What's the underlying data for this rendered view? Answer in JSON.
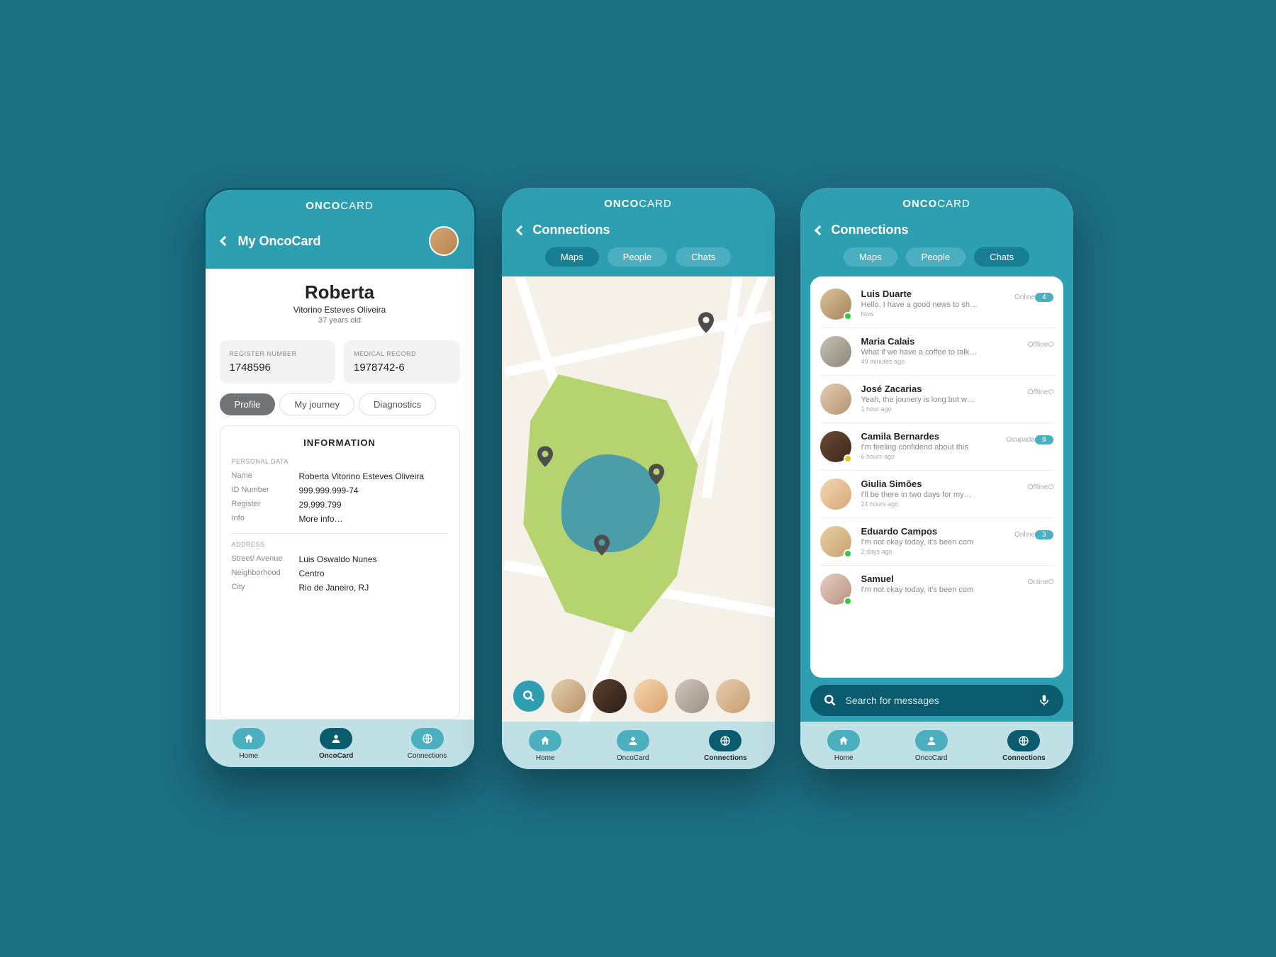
{
  "brand": {
    "bold": "ONCO",
    "light": "CARD"
  },
  "nav": {
    "home": "Home",
    "oncocard": "OncoCard",
    "connections": "Connections"
  },
  "screen1": {
    "title": "My OncoCard",
    "name": "Roberta",
    "fullname": "Vitorino Esteves Oliveira",
    "age": "37 years old",
    "register_label": "REGISTER NUMBER",
    "register_value": "1748596",
    "medical_label": "MEDICAL RECORD",
    "medical_value": "1978742-6",
    "tabs": {
      "profile": "Profile",
      "journey": "My journey",
      "diag": "Diagnostics"
    },
    "info_title": "INFORMATION",
    "personal": {
      "heading": "PERSONAL DATA",
      "name_l": "Name",
      "name_v": "Roberta Vitorino Esteves Oliveira",
      "id_l": "ID Number",
      "id_v": "999.999.999-74",
      "reg_l": "Register",
      "reg_v": "29.999.799",
      "info_l": "Info",
      "info_v": "More info…"
    },
    "address": {
      "heading": "ADDRESS",
      "street_l": "Street/ Avenue",
      "street_v": "Luis Oswaldo Nunes",
      "neigh_l": "Neighborhood",
      "neigh_v": "Centro",
      "city_l": "City",
      "city_v": "Rio de Janeiro, RJ"
    }
  },
  "screen2": {
    "title": "Connections",
    "tabs": {
      "maps": "Maps",
      "people": "People",
      "chats": "Chats"
    }
  },
  "screen3": {
    "title": "Connections",
    "tabs": {
      "maps": "Maps",
      "people": "People",
      "chats": "Chats"
    },
    "search_placeholder": "Search for messages",
    "chats": [
      {
        "name": "Luis Duarte",
        "msg": "Hello, I have a good news to sh…",
        "time": "Now",
        "status": "Online",
        "badge": "4",
        "presence": "online",
        "bg": "linear-gradient(135deg,#d9c29a,#a7855c)"
      },
      {
        "name": "Maria Calais",
        "msg": "What if we have a coffee to talk…",
        "time": "49 minutes ago",
        "status": "Offline",
        "presence": "offline",
        "bg": "linear-gradient(135deg,#c9c2b4,#8a8578)"
      },
      {
        "name": "José Zacarias",
        "msg": "Yeah, the jounery is long but w…",
        "time": "1 hour ago",
        "status": "Offline",
        "presence": "offline",
        "bg": "linear-gradient(135deg,#e4cdb3,#b59373)"
      },
      {
        "name": "Camila Bernardes",
        "msg": "I'm feeling confidend about this",
        "time": "6 hours ago",
        "status": "Ocupada",
        "badge": "9",
        "presence": "busy",
        "bg": "linear-gradient(135deg,#6b4a35,#3c271a)"
      },
      {
        "name": "Giulia Simões",
        "msg": "I'll be there in two days for my…",
        "time": "24 hours ago",
        "status": "Offline",
        "presence": "offline",
        "bg": "linear-gradient(135deg,#f3d7b4,#d9a777)"
      },
      {
        "name": "Eduardo Campos",
        "msg": "I'm not okay today, it's been com",
        "time": "2 days ago",
        "status": "Online",
        "badge": "3",
        "presence": "online",
        "bg": "linear-gradient(135deg,#e7cfa5,#c9a36c)"
      },
      {
        "name": "Samuel",
        "msg": "I'm not okay today, it's been com",
        "time": "",
        "status": "Online",
        "presence": "online",
        "bg": "linear-gradient(135deg,#e6cfc1,#b89180)"
      }
    ]
  }
}
